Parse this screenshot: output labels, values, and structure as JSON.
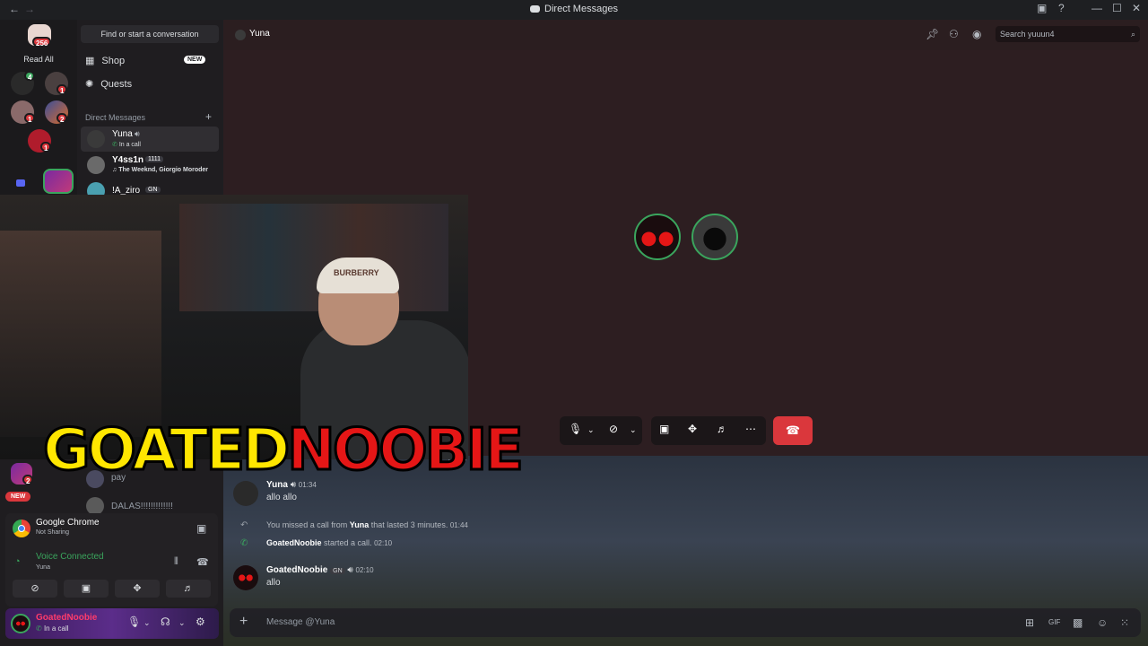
{
  "titlebar": {
    "title": "Direct Messages",
    "back": "←",
    "forward": "→"
  },
  "guilds": {
    "home_badge": "256",
    "read_all": "Read All",
    "badges": [
      "4",
      "1",
      "1",
      "2",
      "1",
      "2"
    ]
  },
  "sidebar": {
    "find_placeholder": "Find or start a conversation",
    "shop_label": "Shop",
    "shop_badge": "NEW",
    "quests_label": "Quests",
    "dm_header": "Direct Messages",
    "dm_add": "+",
    "dms": [
      {
        "name": "Yuna",
        "status": "In a call"
      },
      {
        "name": "Y4ss1n",
        "tag": "1111",
        "status": "The Weeknd, Giorgio Moroder"
      },
      {
        "name": "!A_ziro",
        "tag": "GN"
      }
    ],
    "lower_dms": [
      {
        "name": "pay"
      },
      {
        "name": "DALAS!!!!!!!!!!!!!"
      }
    ],
    "new_pill": "NEW"
  },
  "header": {
    "title": "Yuna",
    "search_placeholder": "Search yuuun4"
  },
  "call": {
    "controls": [
      "mic",
      "camera-off",
      "screen-share",
      "activities",
      "soundboard",
      "more"
    ],
    "hangup": "leave-call"
  },
  "webcam": {
    "cap_text": "BURBERRY"
  },
  "overlay": {
    "yellow_text": "GOATED",
    "red_text": "NOOBIE",
    "yellow_color": "#ffe600",
    "red_color": "#e51616"
  },
  "messages": {
    "partial_time": "01:34",
    "m1": {
      "author": "Yuna",
      "time": "01:34",
      "text": "allo allo"
    },
    "m2": {
      "prefix": "You missed a call from",
      "author": "Yuna",
      "suffix": "that lasted 3 minutes.",
      "time": "01:44"
    },
    "m3": {
      "author": "GoatedNoobie",
      "text": "started a call.",
      "time": "02:10"
    },
    "m4": {
      "author": "GoatedNoobie",
      "tag": "GN",
      "time": "02:10",
      "text": "allo"
    }
  },
  "input": {
    "placeholder": "Message @Yuna"
  },
  "panel": {
    "app_name": "Google Chrome",
    "app_status": "Not Sharing",
    "voice_title": "Voice Connected",
    "voice_channel": "Yuna"
  },
  "user": {
    "name": "GoatedNoobie",
    "status": "In a call"
  },
  "colors": {
    "accent_red": "#da373c",
    "online_green": "#3aa55d",
    "username_pink": "#ff3b6b"
  }
}
